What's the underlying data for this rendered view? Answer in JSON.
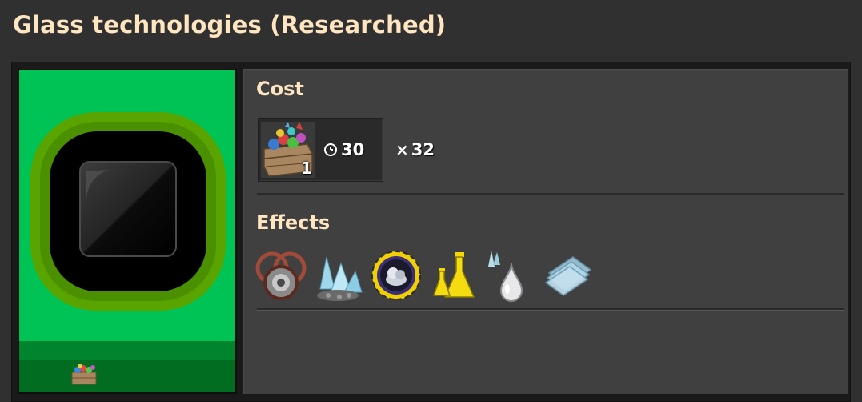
{
  "window": {
    "title": "Glass technologies (Researched)"
  },
  "technology": {
    "icon": "glass-technology-icon",
    "science_pack_icon": "science-pack-crate-icon"
  },
  "cost": {
    "heading": "Cost",
    "ingredients": [
      {
        "icon": "science-pack-crate-icon",
        "count": "1"
      }
    ],
    "time": "30",
    "time_icon": "clock-icon",
    "multiplier_sign": "×",
    "multiplier": "32"
  },
  "effects": {
    "heading": "Effects",
    "items": [
      {
        "icon": "rings-recipe-icon"
      },
      {
        "icon": "quartz-crystal-icon"
      },
      {
        "icon": "quartz-ore-gear-icon"
      },
      {
        "icon": "glass-flask-icon"
      },
      {
        "icon": "molten-glass-drop-icon"
      },
      {
        "icon": "glass-plates-icon"
      }
    ]
  },
  "colors": {
    "title_text": "#ffe6c0",
    "tech_background": "#00c356",
    "panel_background": "#414041"
  }
}
